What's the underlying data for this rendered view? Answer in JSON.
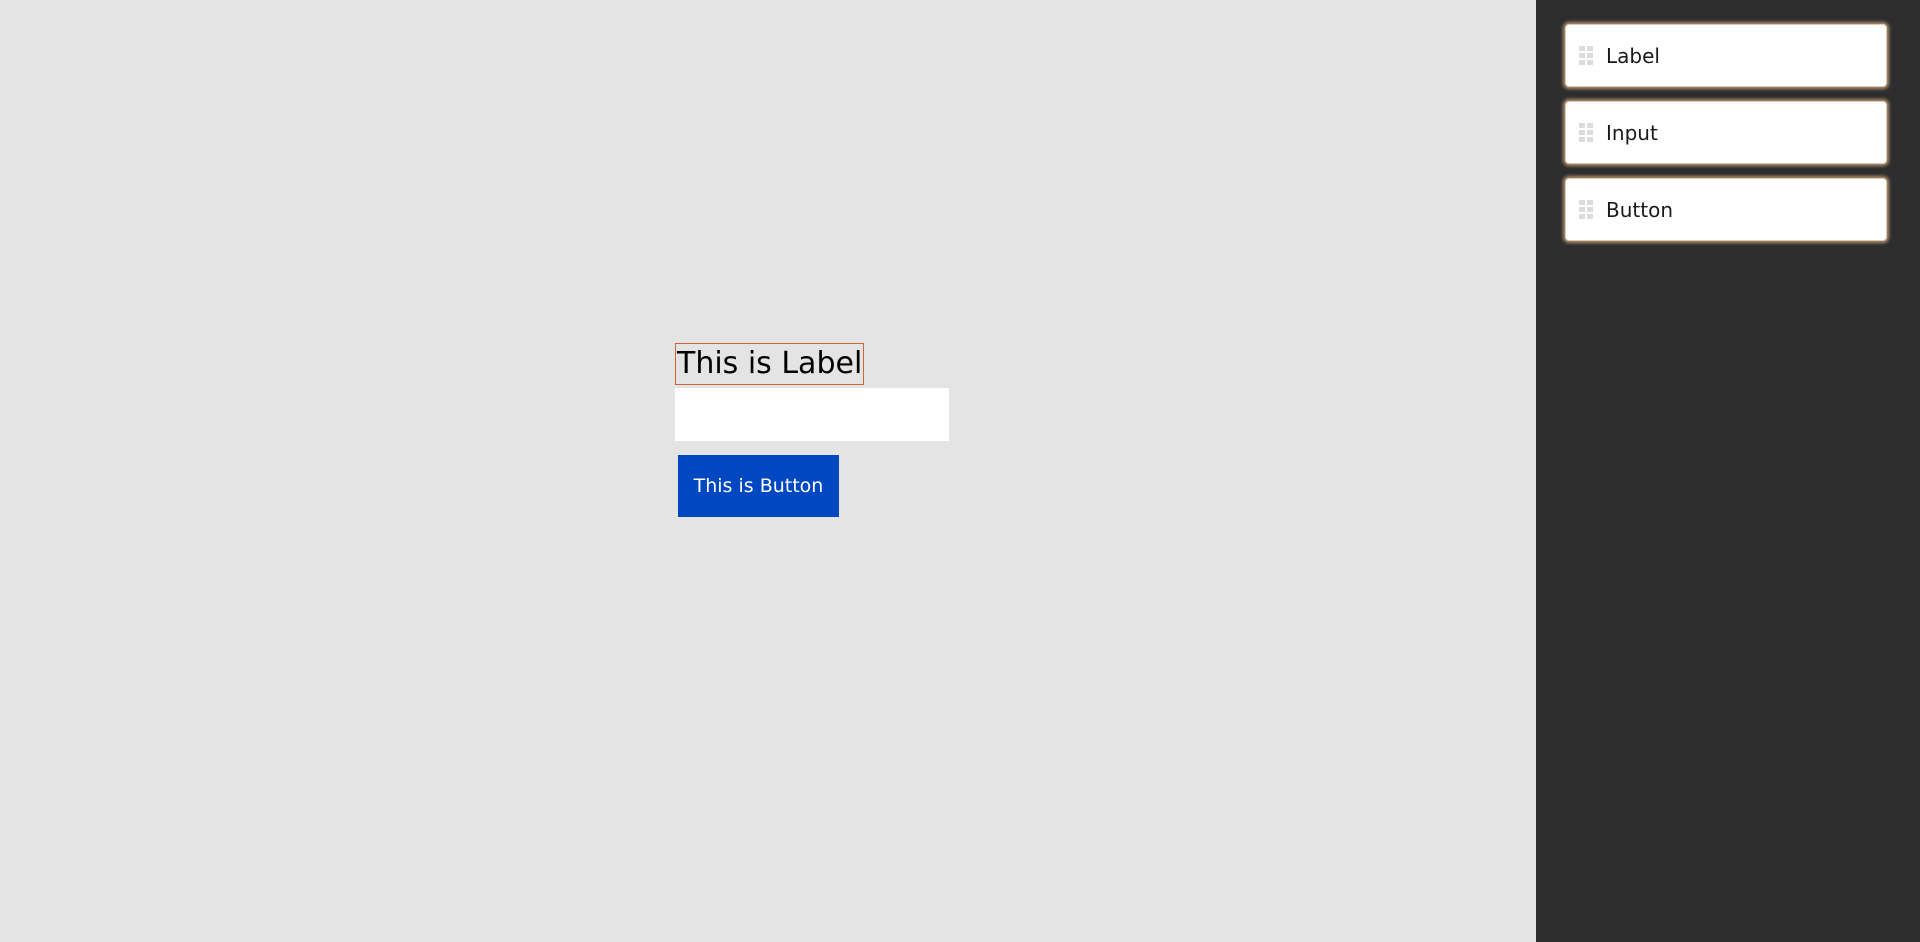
{
  "canvas": {
    "label_text": "This is Label",
    "input": {
      "value": "",
      "placeholder": ""
    },
    "button_text": "This is Button",
    "background_color": "#e4e4e4",
    "selection_border_color": "#c8673a",
    "button_color": "#0047c2"
  },
  "palette": {
    "background_color": "#2d2d2d",
    "items": [
      {
        "label": "Label",
        "icon": "drag-handle-icon"
      },
      {
        "label": "Input",
        "icon": "drag-handle-icon"
      },
      {
        "label": "Button",
        "icon": "drag-handle-icon"
      }
    ]
  }
}
